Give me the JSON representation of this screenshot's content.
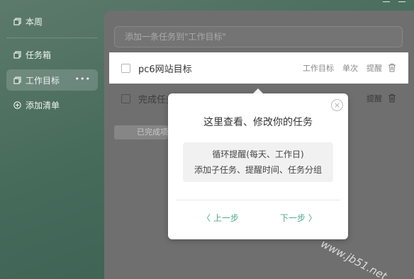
{
  "sidebar": {
    "items": [
      {
        "label": "本周",
        "icon": "copy-icon"
      },
      {
        "label": "任务箱",
        "icon": "copy-icon"
      },
      {
        "label": "工作目标",
        "icon": "copy-icon",
        "more": "•••",
        "active": true
      },
      {
        "label": "添加清单",
        "icon": "plus-circle-icon"
      }
    ]
  },
  "main": {
    "add_placeholder": "添加一条任务到\"工作目标\"",
    "tasks": [
      {
        "title": "pc6网站目标",
        "list_tag": "工作目标",
        "repeat_tag": "单次",
        "remind": "提醒"
      },
      {
        "title": "完成任务",
        "remind": "提醒"
      }
    ],
    "completed_label": "已完成项"
  },
  "tour": {
    "title": "这里查看、修改你的任务",
    "line1": "循环提醒(每天、工作日)",
    "line2": "添加子任务、提醒时间、任务分组",
    "prev": "〈 上一步",
    "next": "下一步 〉",
    "close": "×"
  },
  "watermark": "www.jb51.net",
  "colors": {
    "accent": "#4caa86",
    "sidebar_bg": "#466b5b"
  }
}
